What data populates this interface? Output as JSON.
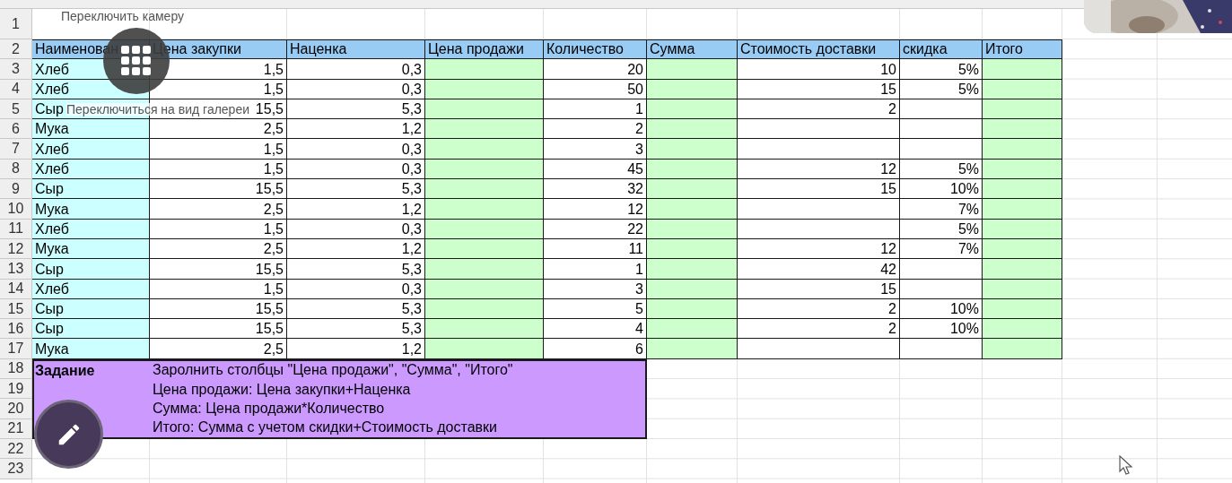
{
  "overlays": {
    "camera_label": "Переключить камеру",
    "gallery_label": "Переключиться на вид галереи"
  },
  "sheet": {
    "row_numbers": [
      "1",
      "2",
      "3",
      "4",
      "5",
      "6",
      "7",
      "8",
      "9",
      "10",
      "11",
      "12",
      "13",
      "14",
      "15",
      "16",
      "17",
      "18",
      "19",
      "20",
      "21",
      "22",
      "23"
    ],
    "header": [
      "Наименован",
      "Цена закупки",
      "Наценка",
      "Цена продажи",
      "Количество",
      "Сумма",
      "Стоимость доставки",
      "скидка",
      "Итого"
    ],
    "rows": [
      {
        "name": "Хлеб",
        "purchase": "1,5",
        "markup": "0,3",
        "quantity": "20",
        "delivery": "10",
        "discount": "5%"
      },
      {
        "name": "Хлеб",
        "purchase": "1,5",
        "markup": "0,3",
        "quantity": "50",
        "delivery": "15",
        "discount": "5%"
      },
      {
        "name": "Сыр",
        "purchase": "15,5",
        "markup": "5,3",
        "quantity": "1",
        "delivery": "2"
      },
      {
        "name": "Мука",
        "purchase": "2,5",
        "markup": "1,2",
        "quantity": "2"
      },
      {
        "name": "Хлеб",
        "purchase": "1,5",
        "markup": "0,3",
        "quantity": "3"
      },
      {
        "name": "Хлеб",
        "purchase": "1,5",
        "markup": "0,3",
        "quantity": "45",
        "delivery": "12",
        "discount": "5%"
      },
      {
        "name": "Сыр",
        "purchase": "15,5",
        "markup": "5,3",
        "quantity": "32",
        "delivery": "15",
        "discount": "10%"
      },
      {
        "name": "Мука",
        "purchase": "2,5",
        "markup": "1,2",
        "quantity": "12",
        "discount": "7%"
      },
      {
        "name": "Хлеб",
        "purchase": "1,5",
        "markup": "0,3",
        "quantity": "22",
        "discount": "5%"
      },
      {
        "name": "Мука",
        "purchase": "2,5",
        "markup": "1,2",
        "quantity": "11",
        "delivery": "12",
        "discount": "7%"
      },
      {
        "name": "Сыр",
        "purchase": "15,5",
        "markup": "5,3",
        "quantity": "1",
        "delivery": "42"
      },
      {
        "name": "Хлеб",
        "purchase": "1,5",
        "markup": "0,3",
        "quantity": "3",
        "delivery": "15"
      },
      {
        "name": "Сыр",
        "purchase": "15,5",
        "markup": "5,3",
        "quantity": "5",
        "delivery": "2",
        "discount": "10%"
      },
      {
        "name": "Сыр",
        "purchase": "15,5",
        "markup": "5,3",
        "quantity": "4",
        "delivery": "2",
        "discount": "10%"
      },
      {
        "name": "Мука",
        "purchase": "2,5",
        "markup": "1,2",
        "quantity": "6"
      }
    ],
    "task": {
      "title": "Задание",
      "lines": [
        "Заролнить столбцы \"Цена продажи\", \"Сумма\", \"Итого\"",
        "Цена продажи: Цена закупки+Наценка",
        "Сумма: Цена продажи*Количество",
        "Итого: Сумма с учетом скидки+Стоимость доставки"
      ]
    }
  }
}
